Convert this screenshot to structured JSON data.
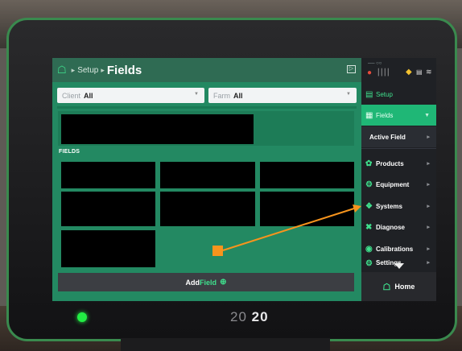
{
  "breadcrumb": {
    "setup_label": "Setup",
    "page_title": "Fields"
  },
  "filters": {
    "client": {
      "label": "Client",
      "value": "All"
    },
    "farm": {
      "label": "Farm",
      "value": "All"
    }
  },
  "fields_section": {
    "heading": "FIELDS",
    "tile_count": 7
  },
  "add_field": {
    "prefix": "Add ",
    "highlight": "Field",
    "plus": "⊕"
  },
  "sidebar": {
    "section_title": "Setup",
    "items": [
      {
        "label": "Fields",
        "icon": "field-icon"
      },
      {
        "label": "Active Field"
      },
      {
        "label": "Products",
        "icon": "products-icon"
      },
      {
        "label": "Equipment",
        "icon": "tractor-icon"
      },
      {
        "label": "Systems",
        "icon": "systems-icon"
      },
      {
        "label": "Diagnose",
        "icon": "wrench-icon"
      },
      {
        "label": "Calibrations",
        "icon": "globe-icon"
      },
      {
        "label": "Settings",
        "icon": "gear-icon"
      }
    ],
    "home_label": "Home"
  },
  "device": {
    "brand_light": "20",
    "brand_bold": "20"
  },
  "colors": {
    "accent_green": "#1fb776",
    "screen_green": "#238962",
    "sidebar_dark": "#1f2125",
    "annotation_orange": "#f7941d"
  }
}
